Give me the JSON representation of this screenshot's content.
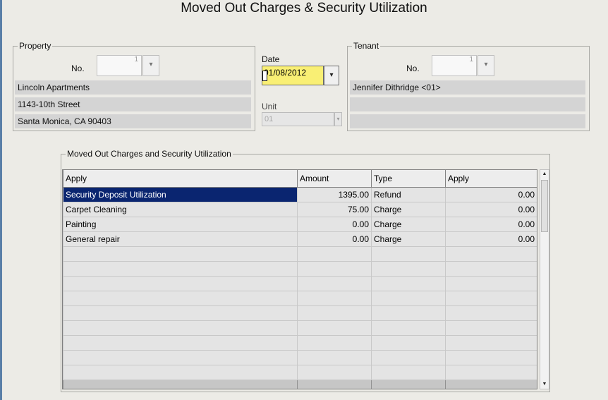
{
  "window": {
    "title": "Moved Out Charges & Security Utilization"
  },
  "property": {
    "group_label": "Property",
    "no_label": "No.",
    "no_value": "1",
    "name": "Lincoln Apartments",
    "street": "1143-10th Street",
    "city": "Santa Monica, CA 90403"
  },
  "date": {
    "label": "Date",
    "value": "01/08/2012"
  },
  "unit": {
    "label": "Unit",
    "value": "01"
  },
  "tenant": {
    "group_label": "Tenant",
    "no_label": "No.",
    "no_value": "1",
    "name": "Jennifer Dithridge <01>",
    "line2": "",
    "line3": ""
  },
  "charges": {
    "group_label": "Moved Out Charges and Security Utilization",
    "columns": [
      "Apply",
      "Amount",
      "Type",
      "Apply"
    ],
    "rows": [
      {
        "apply": "Security Deposit Utilization",
        "amount": "1395.00",
        "type": "Refund",
        "apply_amt": "0.00",
        "selected": true
      },
      {
        "apply": "Carpet Cleaning",
        "amount": "75.00",
        "type": "Charge",
        "apply_amt": "0.00"
      },
      {
        "apply": "Painting",
        "amount": "0.00",
        "type": "Charge",
        "apply_amt": "0.00"
      },
      {
        "apply": "General repair",
        "amount": "0.00",
        "type": "Charge",
        "apply_amt": "0.00"
      }
    ],
    "empty_rows": 9
  },
  "icons": {
    "dropdown": "▾",
    "scroll_up": "▲",
    "scroll_down": "▼"
  },
  "colors": {
    "date_highlight": "#f9ef74",
    "selected_row": "#0a2570"
  }
}
